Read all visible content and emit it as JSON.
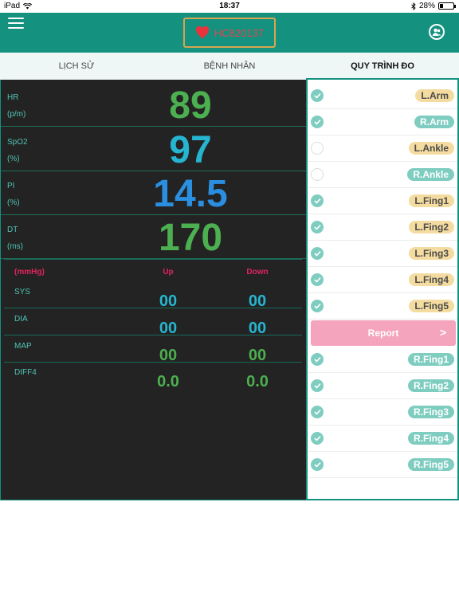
{
  "status_bar": {
    "carrier": "iPad",
    "time": "18:37",
    "battery": "28%",
    "battery_level": 0.28
  },
  "header": {
    "device_id": "HC820137"
  },
  "tabs": [
    {
      "label": "LỊCH SỬ",
      "active": false
    },
    {
      "label": "BỆNH NHÂN",
      "active": false
    },
    {
      "label": "QUY TRÌNH ĐO",
      "active": true
    }
  ],
  "metrics": [
    {
      "label": "HR",
      "unit": "(p/m)",
      "value": "89",
      "color": "#4caf50"
    },
    {
      "label": "SpO2",
      "unit": "(%)",
      "value": "97",
      "color": "#26b5d0"
    },
    {
      "label": "PI",
      "unit": "(%)",
      "value": "14.5",
      "color": "#2a8fe0"
    },
    {
      "label": "DT",
      "unit": "(ms)",
      "value": "170",
      "color": "#4caf50"
    }
  ],
  "bp": {
    "unit": "(mmHg)",
    "col_up": "Up",
    "col_down": "Down",
    "rows": [
      {
        "label": "SYS",
        "up": "00",
        "down": "00",
        "color": "#26b5d0"
      },
      {
        "label": "DIA",
        "up": "00",
        "down": "00",
        "color": "#26b5d0"
      },
      {
        "label": "MAP",
        "up": "00",
        "down": "00",
        "color": "#4caf50"
      },
      {
        "label": "DIFF4",
        "up": "0.0",
        "down": "0.0",
        "color": "#4caf50"
      }
    ]
  },
  "sites_top": [
    {
      "label": "L.Arm",
      "checked": true,
      "style": "yellow"
    },
    {
      "label": "R.Arm",
      "checked": true,
      "style": "teal"
    },
    {
      "label": "L.Ankle",
      "checked": false,
      "style": "yellow"
    },
    {
      "label": "R.Ankle",
      "checked": false,
      "style": "teal"
    },
    {
      "label": "L.Fing1",
      "checked": true,
      "style": "yellow"
    },
    {
      "label": "L.Fing2",
      "checked": true,
      "style": "yellow"
    },
    {
      "label": "L.Fing3",
      "checked": true,
      "style": "yellow"
    },
    {
      "label": "L.Fing4",
      "checked": true,
      "style": "yellow"
    },
    {
      "label": "L.Fing5",
      "checked": true,
      "style": "yellow"
    }
  ],
  "report": {
    "label": "Report",
    "chevron": ">"
  },
  "sites_bottom": [
    {
      "label": "R.Fing1",
      "checked": true,
      "style": "teal"
    },
    {
      "label": "R.Fing2",
      "checked": true,
      "style": "teal"
    },
    {
      "label": "R.Fing3",
      "checked": true,
      "style": "teal"
    },
    {
      "label": "R.Fing4",
      "checked": true,
      "style": "teal"
    },
    {
      "label": "R.Fing5",
      "checked": true,
      "style": "teal"
    }
  ]
}
